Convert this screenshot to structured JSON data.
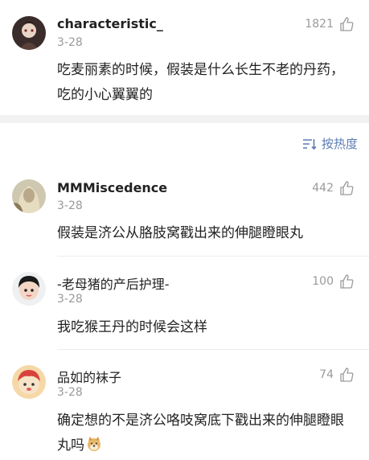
{
  "comments": [
    {
      "username": "characteristic_",
      "date": "3-28",
      "likes": "1821",
      "text": "吃麦丽素的时候，假装是什么长生不老的丹药，吃的小心翼翼的"
    },
    {
      "username": "MMMiscedence",
      "date": "3-28",
      "likes": "442",
      "text": "假装是济公从胳肢窝戳出来的伸腿瞪眼丸"
    },
    {
      "username": "-老母猪的产后护理-",
      "date": "3-28",
      "likes": "100",
      "text": "我吃猴王丹的时候会这样"
    },
    {
      "username": "品如的袜子",
      "date": "3-28",
      "likes": "74",
      "text": "确定想的不是济公咯吱窝底下戳出来的伸腿瞪眼丸吗"
    }
  ],
  "sort": {
    "label": "按热度",
    "icon": "sort-icon"
  },
  "icons": {
    "like": "thumbs-up-icon"
  },
  "colors": {
    "link": "#5b7cb3",
    "meta": "#9a9a9a",
    "divider": "#f2f2f2"
  }
}
